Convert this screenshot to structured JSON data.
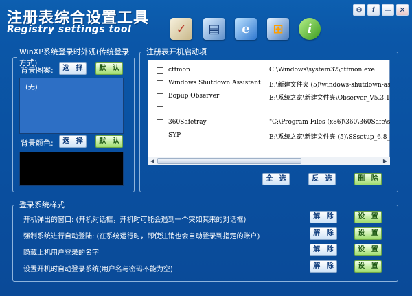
{
  "header": {
    "title_cn": "注册表综合设置工具",
    "title_en": "Registry settings tool",
    "icons": [
      "settings-checklist-icon",
      "display-settings-icon",
      "internet-explorer-icon",
      "windows-security-icon",
      "info-icon"
    ]
  },
  "window_controls": {
    "gear": "⚙",
    "info": "i",
    "minimize": "—",
    "close": "✕"
  },
  "login_panel": {
    "legend": "WinXP系统登录时外观(传统登录方式)",
    "bg_image_label": "背景图案:",
    "select_label": "选 择",
    "default_label": "默 认",
    "bg_image_value": "(无)",
    "bg_color_label": "背景颜色:"
  },
  "startup_panel": {
    "legend": "注册表开机启动项",
    "items": [
      {
        "name": "ctfmon",
        "path": "C:\\Windows\\system32\\ctfmon.exe"
      },
      {
        "name": "Windows Shutdown Assistant",
        "path": "E:\\新建文件夹 (5)\\windows-shutdown-assi"
      },
      {
        "name": "Bopup Observer",
        "path": "E:\\系统之家\\新建文件夹\\Observer_V5.3.1."
      },
      {
        "name": "",
        "path": ""
      },
      {
        "name": "360Safetray",
        "path": "\"C:\\Program Files (x86)\\360\\360Safe\\saf"
      },
      {
        "name": "SYP",
        "path": "E:\\系统之家\\新建文件夹 (5)\\SSsetup_6.8_"
      }
    ],
    "select_all_label": "全 选",
    "invert_label": "反 选",
    "delete_label": "删 除"
  },
  "system_panel": {
    "legend": "登录系统样式",
    "rows": [
      {
        "label": "开机弹出的窗口: (开机对话框，开机时可能会遇到一个突如其来的对话框)",
        "unlock": "解 除",
        "set": "设 置"
      },
      {
        "label": "强制系统进行自动登陆: (在系统运行时，即使注销也会自动登录到指定的账户)",
        "unlock": "解 除",
        "set": "设 置"
      },
      {
        "label": "隐藏上机用户登录的名字",
        "unlock": "解 除",
        "set": "设 置"
      },
      {
        "label": "设置开机时自动登录系统(用户名与密码不能为空)",
        "unlock": "解 除",
        "set": "设 置"
      }
    ]
  },
  "colors": {
    "background": "#0b57a8",
    "list_bg": "#2d6fc5",
    "color_swatch": "#000000",
    "green_button": "#9fdc6d"
  }
}
